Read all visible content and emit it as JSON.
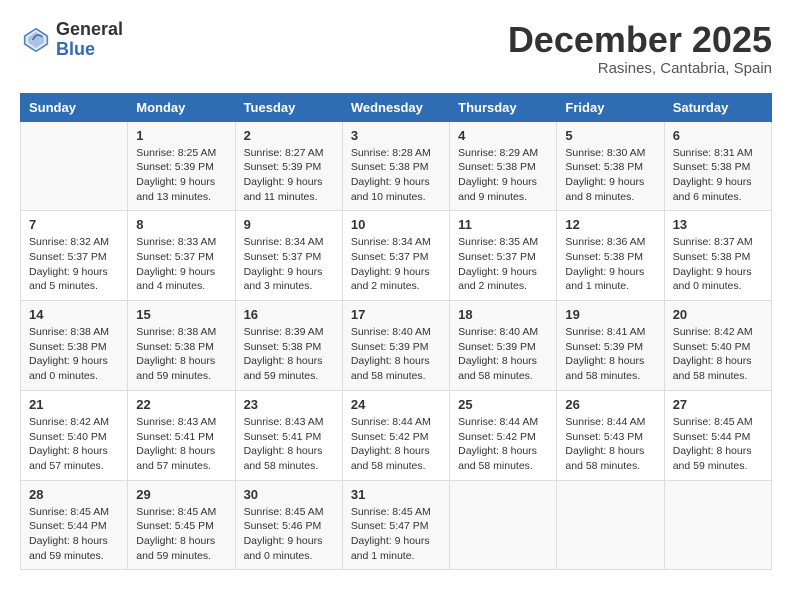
{
  "header": {
    "logo_general": "General",
    "logo_blue": "Blue",
    "month_title": "December 2025",
    "location": "Rasines, Cantabria, Spain"
  },
  "weekdays": [
    "Sunday",
    "Monday",
    "Tuesday",
    "Wednesday",
    "Thursday",
    "Friday",
    "Saturday"
  ],
  "weeks": [
    [
      {
        "day": "",
        "info": ""
      },
      {
        "day": "1",
        "info": "Sunrise: 8:25 AM\nSunset: 5:39 PM\nDaylight: 9 hours\nand 13 minutes."
      },
      {
        "day": "2",
        "info": "Sunrise: 8:27 AM\nSunset: 5:39 PM\nDaylight: 9 hours\nand 11 minutes."
      },
      {
        "day": "3",
        "info": "Sunrise: 8:28 AM\nSunset: 5:38 PM\nDaylight: 9 hours\nand 10 minutes."
      },
      {
        "day": "4",
        "info": "Sunrise: 8:29 AM\nSunset: 5:38 PM\nDaylight: 9 hours\nand 9 minutes."
      },
      {
        "day": "5",
        "info": "Sunrise: 8:30 AM\nSunset: 5:38 PM\nDaylight: 9 hours\nand 8 minutes."
      },
      {
        "day": "6",
        "info": "Sunrise: 8:31 AM\nSunset: 5:38 PM\nDaylight: 9 hours\nand 6 minutes."
      }
    ],
    [
      {
        "day": "7",
        "info": "Sunrise: 8:32 AM\nSunset: 5:37 PM\nDaylight: 9 hours\nand 5 minutes."
      },
      {
        "day": "8",
        "info": "Sunrise: 8:33 AM\nSunset: 5:37 PM\nDaylight: 9 hours\nand 4 minutes."
      },
      {
        "day": "9",
        "info": "Sunrise: 8:34 AM\nSunset: 5:37 PM\nDaylight: 9 hours\nand 3 minutes."
      },
      {
        "day": "10",
        "info": "Sunrise: 8:34 AM\nSunset: 5:37 PM\nDaylight: 9 hours\nand 2 minutes."
      },
      {
        "day": "11",
        "info": "Sunrise: 8:35 AM\nSunset: 5:37 PM\nDaylight: 9 hours\nand 2 minutes."
      },
      {
        "day": "12",
        "info": "Sunrise: 8:36 AM\nSunset: 5:38 PM\nDaylight: 9 hours\nand 1 minute."
      },
      {
        "day": "13",
        "info": "Sunrise: 8:37 AM\nSunset: 5:38 PM\nDaylight: 9 hours\nand 0 minutes."
      }
    ],
    [
      {
        "day": "14",
        "info": "Sunrise: 8:38 AM\nSunset: 5:38 PM\nDaylight: 9 hours\nand 0 minutes."
      },
      {
        "day": "15",
        "info": "Sunrise: 8:38 AM\nSunset: 5:38 PM\nDaylight: 8 hours\nand 59 minutes."
      },
      {
        "day": "16",
        "info": "Sunrise: 8:39 AM\nSunset: 5:38 PM\nDaylight: 8 hours\nand 59 minutes."
      },
      {
        "day": "17",
        "info": "Sunrise: 8:40 AM\nSunset: 5:39 PM\nDaylight: 8 hours\nand 58 minutes."
      },
      {
        "day": "18",
        "info": "Sunrise: 8:40 AM\nSunset: 5:39 PM\nDaylight: 8 hours\nand 58 minutes."
      },
      {
        "day": "19",
        "info": "Sunrise: 8:41 AM\nSunset: 5:39 PM\nDaylight: 8 hours\nand 58 minutes."
      },
      {
        "day": "20",
        "info": "Sunrise: 8:42 AM\nSunset: 5:40 PM\nDaylight: 8 hours\nand 58 minutes."
      }
    ],
    [
      {
        "day": "21",
        "info": "Sunrise: 8:42 AM\nSunset: 5:40 PM\nDaylight: 8 hours\nand 57 minutes."
      },
      {
        "day": "22",
        "info": "Sunrise: 8:43 AM\nSunset: 5:41 PM\nDaylight: 8 hours\nand 57 minutes."
      },
      {
        "day": "23",
        "info": "Sunrise: 8:43 AM\nSunset: 5:41 PM\nDaylight: 8 hours\nand 58 minutes."
      },
      {
        "day": "24",
        "info": "Sunrise: 8:44 AM\nSunset: 5:42 PM\nDaylight: 8 hours\nand 58 minutes."
      },
      {
        "day": "25",
        "info": "Sunrise: 8:44 AM\nSunset: 5:42 PM\nDaylight: 8 hours\nand 58 minutes."
      },
      {
        "day": "26",
        "info": "Sunrise: 8:44 AM\nSunset: 5:43 PM\nDaylight: 8 hours\nand 58 minutes."
      },
      {
        "day": "27",
        "info": "Sunrise: 8:45 AM\nSunset: 5:44 PM\nDaylight: 8 hours\nand 59 minutes."
      }
    ],
    [
      {
        "day": "28",
        "info": "Sunrise: 8:45 AM\nSunset: 5:44 PM\nDaylight: 8 hours\nand 59 minutes."
      },
      {
        "day": "29",
        "info": "Sunrise: 8:45 AM\nSunset: 5:45 PM\nDaylight: 8 hours\nand 59 minutes."
      },
      {
        "day": "30",
        "info": "Sunrise: 8:45 AM\nSunset: 5:46 PM\nDaylight: 9 hours\nand 0 minutes."
      },
      {
        "day": "31",
        "info": "Sunrise: 8:45 AM\nSunset: 5:47 PM\nDaylight: 9 hours\nand 1 minute."
      },
      {
        "day": "",
        "info": ""
      },
      {
        "day": "",
        "info": ""
      },
      {
        "day": "",
        "info": ""
      }
    ]
  ]
}
